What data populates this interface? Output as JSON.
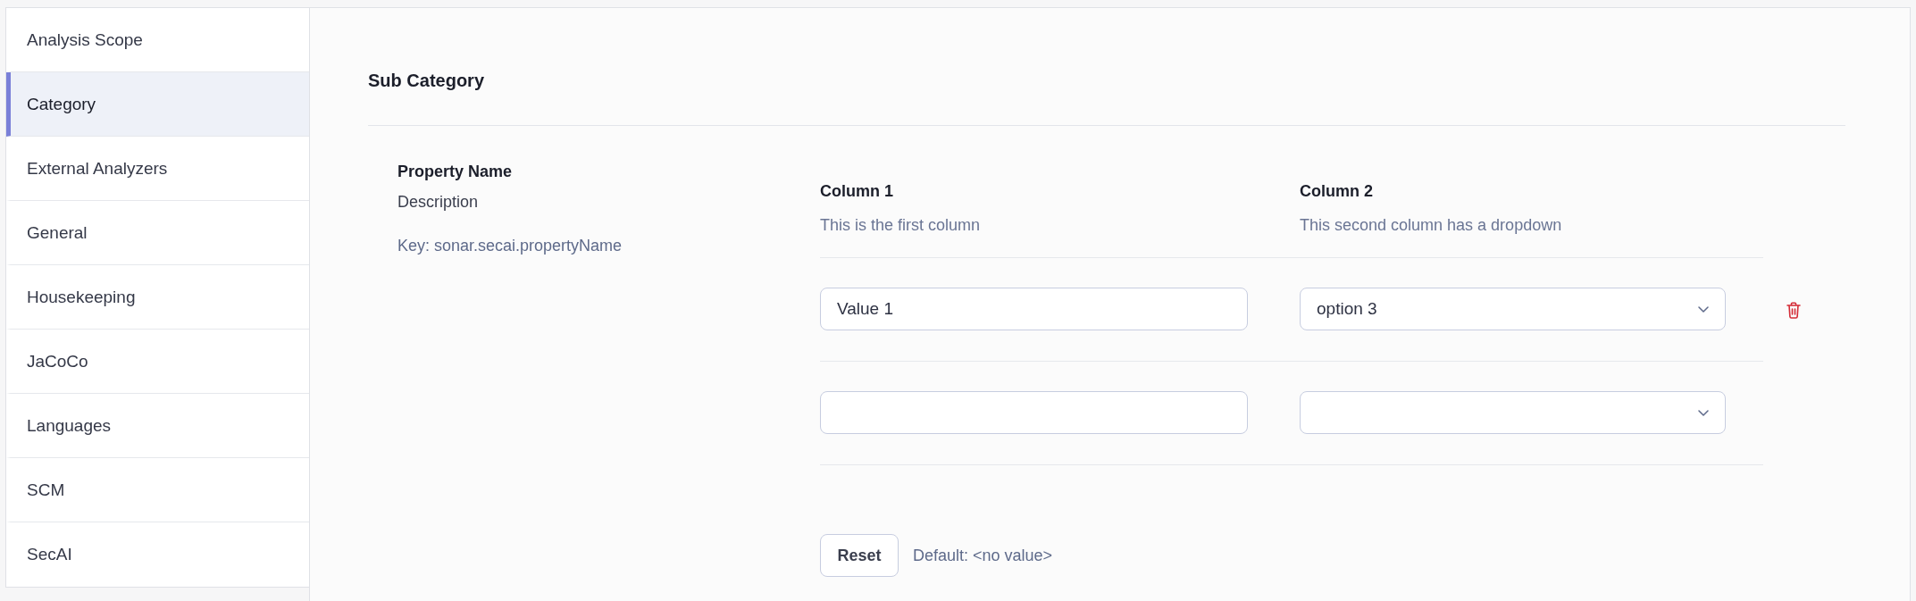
{
  "sidebar": {
    "items": [
      {
        "label": "Analysis Scope",
        "selected": false
      },
      {
        "label": "Category",
        "selected": true
      },
      {
        "label": "External Analyzers",
        "selected": false
      },
      {
        "label": "General",
        "selected": false
      },
      {
        "label": "Housekeeping",
        "selected": false
      },
      {
        "label": "JaCoCo",
        "selected": false
      },
      {
        "label": "Languages",
        "selected": false
      },
      {
        "label": "SCM",
        "selected": false
      },
      {
        "label": "SecAI",
        "selected": false
      }
    ]
  },
  "section": {
    "title": "Sub Category"
  },
  "property": {
    "name": "Property Name",
    "description": "Description",
    "key": "Key: sonar.secai.propertyName"
  },
  "table": {
    "columns": [
      {
        "title": "Column 1",
        "description": "This is the first column"
      },
      {
        "title": "Column 2",
        "description": "This second column has a dropdown"
      }
    ],
    "rows": [
      {
        "cells": [
          {
            "kind": "input",
            "value": "Value 1"
          },
          {
            "kind": "select",
            "value": "option 3"
          }
        ],
        "deletable": true
      },
      {
        "cells": [
          {
            "kind": "input"
          },
          {
            "kind": "select"
          }
        ],
        "deletable": false
      }
    ]
  },
  "reset_button": "Reset",
  "default_text": "Default: <no value>"
}
